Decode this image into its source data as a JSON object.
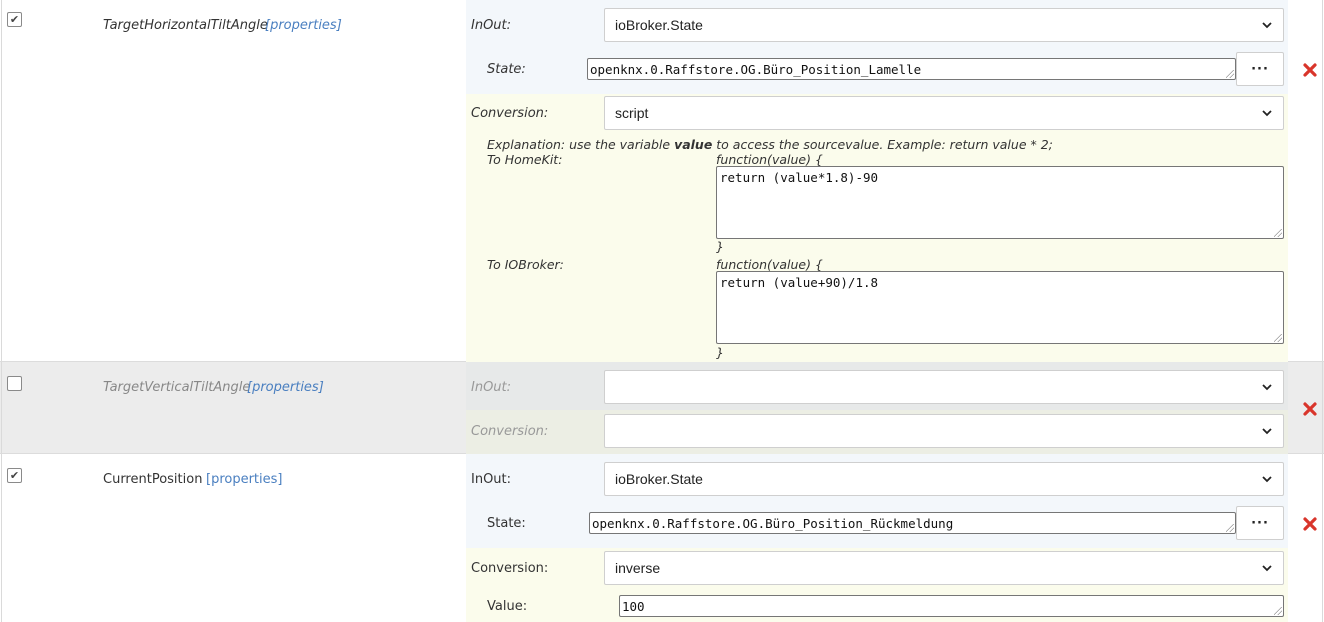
{
  "rows": [
    {
      "characteristic": "TargetHorizontalTiltAngle",
      "properties_link": "[properties]",
      "enabled": true,
      "inout_label": "InOut:",
      "inout_value": "ioBroker.State",
      "state_label": "State:",
      "state_value": "openknx.0.Raffstore.OG.Büro_Position_Lamelle",
      "browse_label": "···",
      "conversion_label": "Conversion:",
      "conversion_value": "script",
      "explanation_prefix": "Explanation: use the variable ",
      "explanation_keyword": "value",
      "explanation_suffix": " to access the sourcevalue. Example: return value * 2;",
      "to_homekit_label": "To HomeKit:",
      "to_homekit_header": "function(value) {",
      "to_homekit_code": "return (value*1.8)-90",
      "to_homekit_footer": "}",
      "to_iobroker_label": "To IOBroker:",
      "to_iobroker_header": "function(value) {",
      "to_iobroker_code": "return (value+90)/1.8",
      "to_iobroker_footer": "}"
    },
    {
      "characteristic": "TargetVerticalTiltAngle",
      "properties_link": "[properties]",
      "enabled": false,
      "inout_label": "InOut:",
      "inout_value": "",
      "conversion_label": "Conversion:",
      "conversion_value": ""
    },
    {
      "characteristic": "CurrentPosition",
      "properties_link": "[properties]",
      "enabled": true,
      "inout_label": "InOut:",
      "inout_value": "ioBroker.State",
      "state_label": "State:",
      "state_value": "openknx.0.Raffstore.OG.Büro_Position_Rückmeldung",
      "browse_label": "···",
      "conversion_label": "Conversion:",
      "conversion_value": "inverse",
      "value_label": "Value:",
      "value_value": "100"
    }
  ],
  "icons": {
    "checkmark": "✔",
    "delete_color": "#d9352b",
    "link_color": "#4a7fc0"
  }
}
